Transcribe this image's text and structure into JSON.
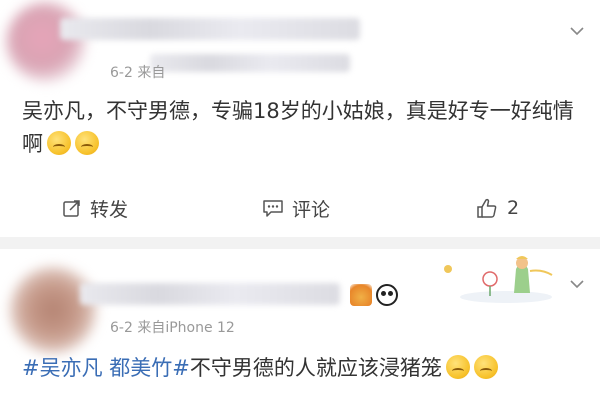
{
  "posts": [
    {
      "meta": "6-2  来自",
      "text": "吴亦凡，不守男德，专骗18岁的小姑娘，真是好专一好纯情啊",
      "emojis": [
        "sneeze-emoji",
        "sneeze-emoji"
      ],
      "actions": {
        "share": "转发",
        "comment": "评论",
        "like_count": "2"
      }
    },
    {
      "meta": "6-2  来自iPhone 12",
      "hashtag1": "#吴亦凡",
      "hashtag2": "都美竹#",
      "text": "不守男德的人就应该浸猪笼",
      "emojis": [
        "pleading-emoji",
        "pleading-emoji"
      ]
    }
  ],
  "colors": {
    "hashtag": "#3a6db5",
    "meta": "#999999",
    "divider": "#f2f2f2"
  },
  "icons": {
    "share": "share-icon",
    "comment": "comment-icon",
    "like": "thumbs-up-icon",
    "menu": "chevron-down-icon"
  }
}
